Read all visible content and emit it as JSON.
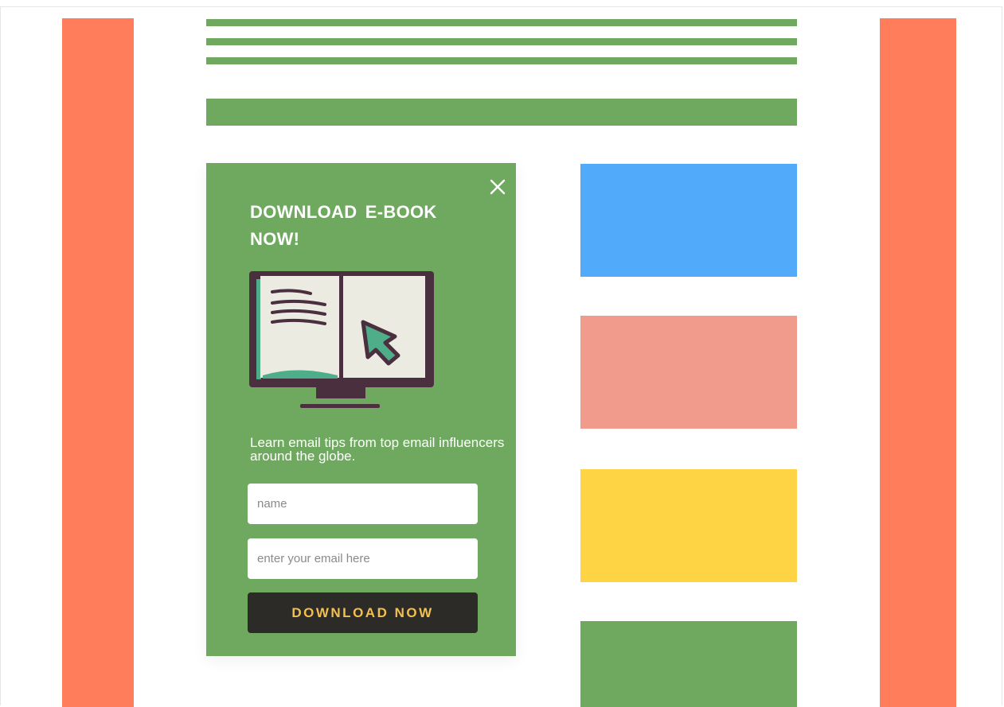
{
  "colors": {
    "side": "#ff7d5a",
    "green": "#6fa95f",
    "blue": "#52aafb",
    "salmon": "#f09b8c",
    "yellow": "#fed344",
    "cta_text": "#f3c04e",
    "book_dark": "#4a2f3f",
    "book_page": "#ecebe2",
    "cursor": "#4fae8a"
  },
  "popup": {
    "title": "DOWNLOAD  E-BOOK NOW!",
    "description": "Learn email tips from top email influencers around the globe.",
    "name_placeholder": "name",
    "email_placeholder": "enter your email here",
    "cta_label": "DOWNLOAD NOW",
    "close_icon": "close-icon",
    "illustration_icon": "ebook-monitor-icon"
  },
  "sidebar_cards": [
    {
      "color": "#52aafb"
    },
    {
      "color": "#f09b8c"
    },
    {
      "color": "#fed344"
    },
    {
      "color": "#6fa95f"
    }
  ]
}
